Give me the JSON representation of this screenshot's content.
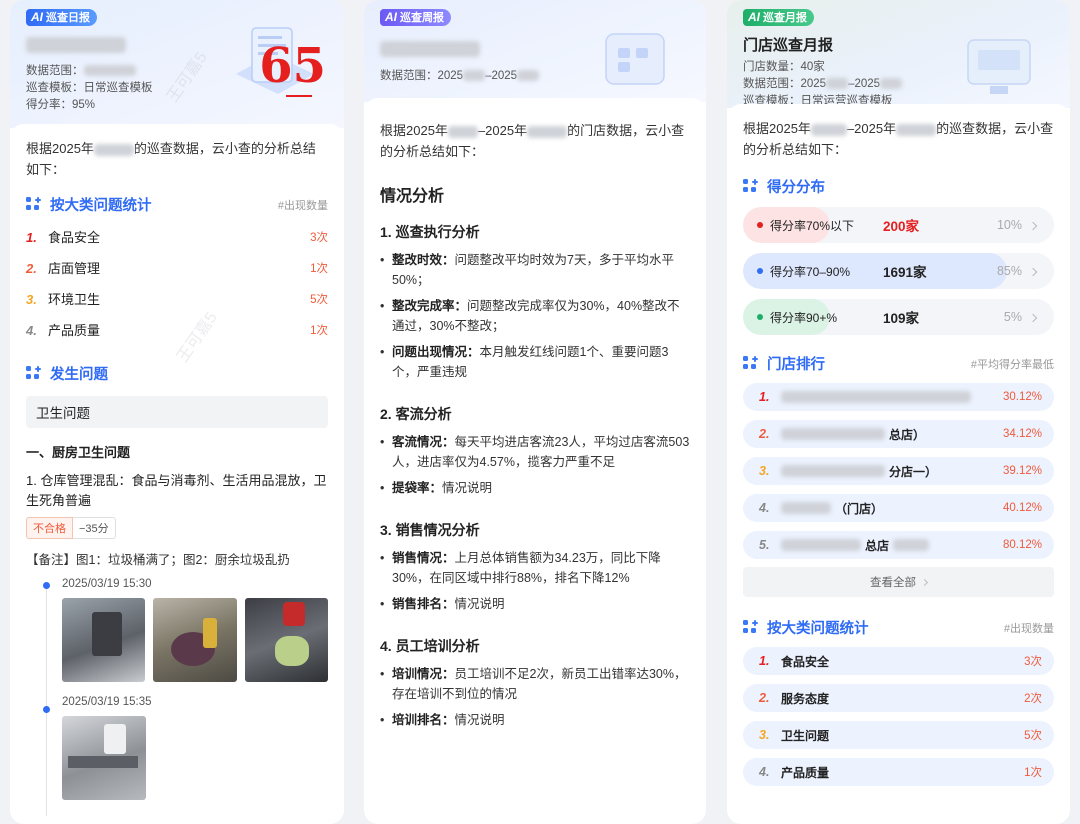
{
  "colors": {
    "accent": "#2f6bf5",
    "red": "#e51e1e",
    "orange": "#f05b3a",
    "gold": "#f5a623",
    "green": "#1fae6a"
  },
  "daily": {
    "tag": "巡查日报",
    "range_label": "数据范围：",
    "template_label": "巡查模板：",
    "template": "日常巡查模板",
    "rate_label": "得分率：",
    "rate": "95%",
    "score": "65",
    "intro_a": "根据2025年",
    "intro_b": "的巡查数据，云小查的分析总结如下：",
    "cat_title": "按大类问题统计",
    "cat_hint": "#出现数量",
    "categories": [
      {
        "n": "1.",
        "name": "食品安全",
        "count": "3次"
      },
      {
        "n": "2.",
        "name": "店面管理",
        "count": "1次"
      },
      {
        "n": "3.",
        "name": "环境卫生",
        "count": "5次"
      },
      {
        "n": "4.",
        "name": "产品质量",
        "count": "1次"
      }
    ],
    "issue_title": "发生问题",
    "group": "卫生问题",
    "sub": "一、厨房卫生问题",
    "item": "1. 仓库管理混乱：食品与消毒剂、生活用品混放，卫生死角普遍",
    "badge_fail": "不合格",
    "badge_score": "−35分",
    "note": "【备注】图1：垃圾桶满了；图2：厨余垃圾乱扔",
    "time1": "2025/03/19 15:30",
    "time2": "2025/03/19 15:35",
    "watermark": "王可嘉5"
  },
  "weekly": {
    "tag": "巡查周报",
    "range_label": "数据范围：",
    "range_a": "2025",
    "range_b": "–2025",
    "intro": "根据2025年",
    "intro_mid": "–2025年",
    "intro_end": "的门店数据，云小查的分析总结如下：",
    "h_main": "情况分析",
    "s1": "1. 巡查执行分析",
    "b1_k": "整改时效：",
    "b1_v": "问题整改平均时效为7天，多于平均水平50%；",
    "b2_k": "整改完成率：",
    "b2_v": "问题整改完成率仅为30%，40%整改不通过，30%不整改；",
    "b3_k": "问题出现情况：",
    "b3_v": "本月触发红线问题1个、重要问题3个，严重违规",
    "s2": "2. 客流分析",
    "b4_k": "客流情况：",
    "b4_v": "每天平均进店客流23人，平均过店客流503人，进店率仅为4.57%，揽客力严重不足",
    "b5_k": "提袋率：",
    "b5_v": "情况说明",
    "s3": "3. 销售情况分析",
    "b6_k": "销售情况：",
    "b6_v": "上月总体销售额为34.23万，同比下降30%，在同区域中排行88%，排名下降12%",
    "b7_k": "销售排名：",
    "b7_v": "情况说明",
    "s4": "4. 员工培训分析",
    "b8_k": "培训情况：",
    "b8_v": "员工培训不足2次，新员工出错率达30%，存在培训不到位的情况",
    "b9_k": "培训排名：",
    "b9_v": "情况说明"
  },
  "monthly": {
    "tag": "巡查月报",
    "title": "门店巡查月报",
    "stores_label": "门店数量：",
    "stores": "40家",
    "range_label": "数据范围：",
    "range_a": "2025",
    "range_b": "–2025",
    "template_label": "巡查模板：",
    "template": "日常运营巡查模板",
    "intro": "根据2025年",
    "intro_mid": "–2025年",
    "intro_end": "的巡查数据，云小查的分析总结如下：",
    "dist_title": "得分分布",
    "dist": [
      {
        "label": "得分率70%以下",
        "value": "200家",
        "pct": "10%",
        "share": 0.1,
        "color": "#e51e1e",
        "fill": "#fde3e3"
      },
      {
        "label": "得分率70–90%",
        "value": "1691家",
        "pct": "85%",
        "share": 0.85,
        "color": "#2f6bf5",
        "fill": "#dde7fd"
      },
      {
        "label": "得分率90+%",
        "value": "109家",
        "pct": "5%",
        "share": 0.05,
        "color": "#1fae6a",
        "fill": "#daf3e5"
      }
    ],
    "rank_title": "门店排行",
    "rank_hint": "#平均得分率最低",
    "stores_rank": [
      {
        "n": "1.",
        "suffix": "",
        "pct": "30.12%"
      },
      {
        "n": "2.",
        "suffix": "总店）",
        "pct": "34.12%"
      },
      {
        "n": "3.",
        "suffix": "分店一）",
        "pct": "39.12%"
      },
      {
        "n": "4.",
        "suffix": "（门店）",
        "pct": "40.12%"
      },
      {
        "n": "5.",
        "suffix": "总店",
        "pct": "80.12%"
      }
    ],
    "see_all": "查看全部",
    "cat_title": "按大类问题统计",
    "cat_hint": "#出现数量",
    "categories": [
      {
        "n": "1.",
        "name": "食品安全",
        "count": "3次"
      },
      {
        "n": "2.",
        "name": "服务态度",
        "count": "2次"
      },
      {
        "n": "3.",
        "name": "卫生问题",
        "count": "5次"
      },
      {
        "n": "4.",
        "name": "产品质量",
        "count": "1次"
      }
    ]
  }
}
